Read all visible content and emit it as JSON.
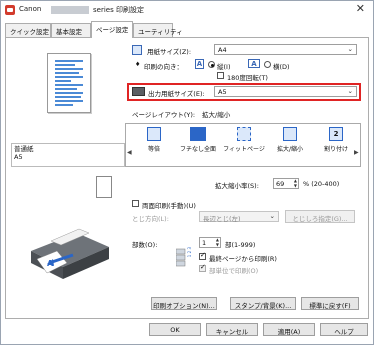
{
  "window": {
    "brand": "Canon",
    "title_rest": "series 印刷設定",
    "close_glyph": "✕"
  },
  "tabs": [
    {
      "label": "クイック設定",
      "active": false
    },
    {
      "label": "基本設定",
      "active": false
    },
    {
      "label": "ページ設定",
      "active": true
    },
    {
      "label": "ユーティリティ",
      "active": false
    }
  ],
  "preview": {
    "media_type": "普通紙",
    "size": "A5"
  },
  "page_size": {
    "label": "用紙サイズ(Z):",
    "value": "A4"
  },
  "orientation": {
    "label": "印刷の向き：",
    "portrait_icon": "A",
    "portrait_label": "縦(I)",
    "landscape_icon": "A",
    "landscape_label": "横(D)",
    "selected": "portrait",
    "rotate_label": "180度回転(T)"
  },
  "output_size": {
    "label": "出力用紙サイズ(E):",
    "value": "A5"
  },
  "layout": {
    "label": "ページレイアウト(Y):",
    "current": "拡大/縮小",
    "items": [
      {
        "label": "等倍",
        "selected": false
      },
      {
        "label": "フチなし全面",
        "selected": false
      },
      {
        "label": "フィットページ",
        "selected": false
      },
      {
        "label": "拡大/縮小",
        "selected": true
      },
      {
        "label": "割り付け",
        "selected": false
      }
    ],
    "item5_number": "2",
    "scroll_left": "◀",
    "scroll_right": "▶"
  },
  "scaling": {
    "label": "拡大縮小率(S):",
    "value": "69",
    "range": "% (20-400)"
  },
  "duplex": {
    "label": "両面印刷(手動)(U)",
    "binding_label": "とじ方向(L):",
    "binding_value": "長辺とじ(左)",
    "margin_button": "とじしろ指定(G)..."
  },
  "copies": {
    "label": "部数(O):",
    "value": "1",
    "range": "部(1-999)",
    "last_page_first": "最終ページから印刷(R)",
    "collate": "部単位で印刷(O)",
    "icon_text": "1 2 3"
  },
  "buttons": {
    "print_options": "印刷オプション(N)...",
    "stamp": "スタンプ/背景(K)...",
    "defaults": "標準に戻す(F)"
  },
  "dialog": {
    "ok": "OK",
    "cancel": "キャンセル",
    "apply": "適用(A)",
    "help": "ヘルプ"
  },
  "colors": {
    "highlight": "#e02424",
    "accent": "#2b66c7"
  }
}
